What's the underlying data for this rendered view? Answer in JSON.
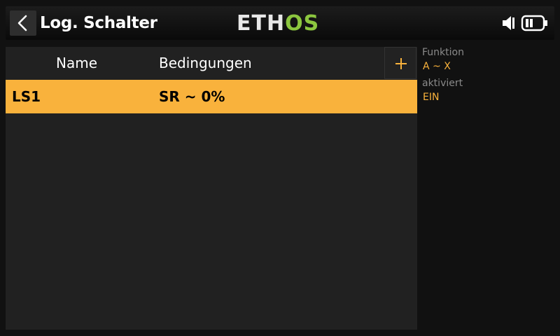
{
  "header": {
    "title": "Log. Schalter",
    "logo_main": "ETH",
    "logo_accent": "OS",
    "back_icon": "chevron-left-icon",
    "speaker_icon": "speaker-icon",
    "battery_icon": "battery-icon"
  },
  "list": {
    "columns": {
      "name": "Name",
      "conditions": "Bedingungen"
    },
    "add_icon": "plus-icon",
    "rows": [
      {
        "name": "LS1",
        "conditions": "SR ~ 0%",
        "selected": true
      }
    ]
  },
  "detail": {
    "function_label": "Funktion",
    "function_value": "A ~ X",
    "active_label": "aktiviert",
    "active_value": "EIN"
  },
  "colors": {
    "accent": "#f9b23c",
    "logo_green": "#8cc63f",
    "panel_bg": "#212121",
    "screen_bg": "#111111"
  }
}
